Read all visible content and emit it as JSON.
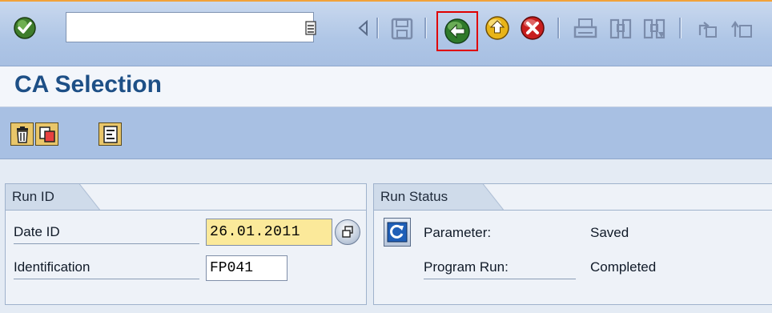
{
  "toolbar": {
    "command_field_value": "",
    "icons": [
      "enter-icon",
      "history-icon",
      "left-arrow-icon",
      "save-icon",
      "back-icon",
      "exit-icon",
      "cancel-icon",
      "print-icon",
      "find-icon",
      "find-next-icon",
      "first-page-icon",
      "previous-page-icon"
    ],
    "highlight_color": "#e00000"
  },
  "title": "CA Selection",
  "app_toolbar": {
    "icons": [
      "delete-icon",
      "copy-icon",
      "log-icon"
    ]
  },
  "run_id_group": {
    "title": "Run ID",
    "date_id_label": "Date ID",
    "date_id_value": "26.01.2011",
    "identification_label": "Identification",
    "identification_value": "FP041"
  },
  "run_status_group": {
    "title": "Run Status",
    "parameter_label": "Parameter:",
    "parameter_value": "Saved",
    "program_run_label": "Program Run:",
    "program_run_value": "Completed"
  },
  "colors": {
    "title": "#1d4f86",
    "toolbar_bg": "#a8c0e3",
    "input_required_bg": "#fbe99a"
  }
}
